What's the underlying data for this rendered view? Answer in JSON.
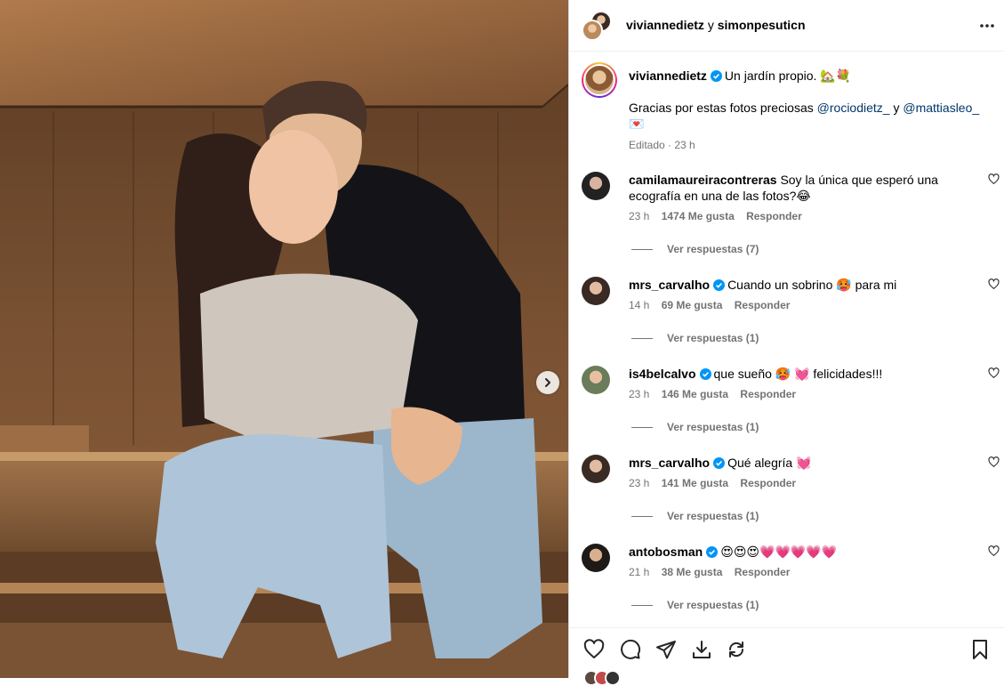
{
  "header": {
    "user1": "viviannedietz",
    "joiner": "y",
    "user2": "simonpesuticn"
  },
  "caption": {
    "username": "viviannedietz",
    "line1": "Un jardín propio. 🏡💐",
    "line2_prefix": "Gracias por estas fotos preciosas",
    "mention1": "@rociodietz_",
    "joiner": "y",
    "mention2": "@mattiasleo_",
    "emoji": "💌",
    "meta": "Editado · 23 h"
  },
  "comments": [
    {
      "username": "camilamaureiracontreras",
      "verified": false,
      "text": "Soy la única que esperó una ecografía en una de las fotos?😂",
      "time": "23 h",
      "likes": "1474 Me gusta",
      "reply": "Responder",
      "replies": "Ver respuestas (7)"
    },
    {
      "username": "mrs_carvalho",
      "verified": true,
      "text": "Cuando un sobrino 🥵 para mi",
      "time": "14 h",
      "likes": "69 Me gusta",
      "reply": "Responder",
      "replies": "Ver respuestas (1)"
    },
    {
      "username": "is4belcalvo",
      "verified": true,
      "text": "que sueño 🥵 💓 felicidades!!!",
      "time": "23 h",
      "likes": "146 Me gusta",
      "reply": "Responder",
      "replies": "Ver respuestas (1)"
    },
    {
      "username": "mrs_carvalho",
      "verified": true,
      "text": "Qué alegría 💓",
      "time": "23 h",
      "likes": "141 Me gusta",
      "reply": "Responder",
      "replies": "Ver respuestas (1)"
    },
    {
      "username": "antobosman",
      "verified": true,
      "text": "😍😍😍💗💗💗💗💗",
      "time": "21 h",
      "likes": "38 Me gusta",
      "reply": "Responder",
      "replies": "Ver respuestas (1)"
    }
  ],
  "colors": {
    "verified": "#0095f6",
    "mention": "#00376b",
    "muted": "#737373"
  },
  "icons": [
    "heart-icon",
    "comment-icon",
    "share-icon",
    "download-icon",
    "remix-icon",
    "bookmark-icon",
    "more-icon",
    "chevron-right-icon",
    "verified-icon"
  ]
}
